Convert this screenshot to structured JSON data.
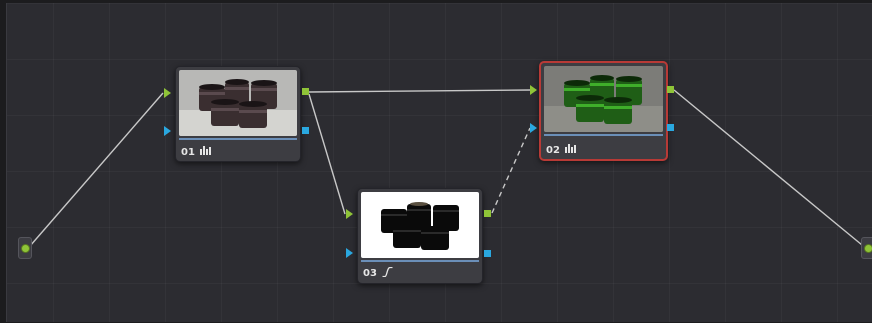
{
  "nodes": [
    {
      "id": "01",
      "label": "01",
      "tool_icon": "bars-icon"
    },
    {
      "id": "02",
      "label": "02",
      "tool_icon": "bars-icon",
      "selected": true
    },
    {
      "id": "03",
      "label": "03",
      "tool_icon": "curve-icon"
    }
  ],
  "colors": {
    "background": "#2c2c31",
    "node_body": "#3d3d42",
    "selected_border": "#b83a36",
    "rgb_port": "#8fc438",
    "key_port": "#2aa8e0",
    "wire": "#c8c8c8"
  }
}
